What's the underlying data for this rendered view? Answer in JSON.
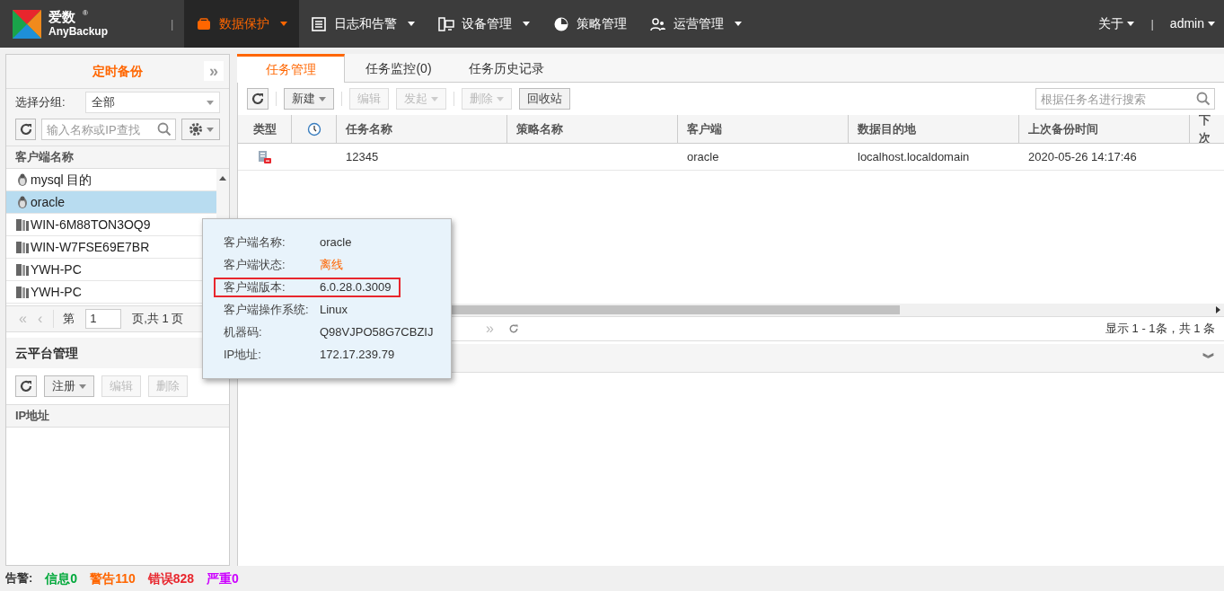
{
  "header": {
    "logo_title": "爱数",
    "logo_mark": "®",
    "logo_subtitle": "AnyBackup",
    "separator": "|",
    "nav": [
      {
        "label": "数据保护",
        "selected": true,
        "dropdown": true
      },
      {
        "label": "日志和告警",
        "selected": false,
        "dropdown": true
      },
      {
        "label": "设备管理",
        "selected": false,
        "dropdown": true
      },
      {
        "label": "策略管理",
        "selected": false,
        "dropdown": false
      },
      {
        "label": "运营管理",
        "selected": false,
        "dropdown": true
      }
    ],
    "right": [
      {
        "label": "关于",
        "dropdown": true
      },
      {
        "label": "admin",
        "dropdown": true
      }
    ],
    "right_separator": "|"
  },
  "sidebar": {
    "title": "定时备份",
    "collapse": "»",
    "group_label": "选择分组:",
    "group_value": "全部",
    "search_placeholder": "输入名称或IP查找",
    "column": "客户端名称",
    "clients": [
      {
        "name": "mysql 目的",
        "kind": "linux",
        "selected": false
      },
      {
        "name": "oracle",
        "kind": "linux",
        "selected": true
      },
      {
        "name": "WIN-6M88TON3OQ9",
        "kind": "windows",
        "selected": false
      },
      {
        "name": "WIN-W7FSE69E7BR",
        "kind": "windows",
        "selected": false
      },
      {
        "name": "YWH-PC",
        "kind": "windows",
        "selected": false
      },
      {
        "name": "YWH-PC",
        "kind": "windows",
        "selected": false
      }
    ],
    "pager": {
      "first": "«",
      "prev": "‹",
      "page_label": "第",
      "page": "1",
      "total": "页,共 1 页"
    },
    "cloud": {
      "title": "云平台管理",
      "buttons": [
        {
          "label": "注册",
          "disabled": false,
          "dropdown": true
        },
        {
          "label": "编辑",
          "disabled": true,
          "dropdown": false
        },
        {
          "label": "删除",
          "disabled": true,
          "dropdown": false
        }
      ],
      "column": "IP地址"
    }
  },
  "main": {
    "tabs": [
      {
        "label": "任务管理",
        "selected": true
      },
      {
        "label": "任务监控(0)",
        "selected": false
      },
      {
        "label": "任务历史记录",
        "selected": false
      }
    ],
    "toolbar": [
      {
        "label": "新建",
        "disabled": false,
        "dropdown": true
      },
      {
        "label": "编辑",
        "disabled": true,
        "dropdown": false
      },
      {
        "label": "发起",
        "disabled": true,
        "dropdown": true
      },
      {
        "label": "删除",
        "disabled": true,
        "dropdown": true
      },
      {
        "label": "回收站",
        "disabled": false,
        "dropdown": false
      }
    ],
    "search_placeholder": "根据任务名进行搜索",
    "table": {
      "columns": [
        {
          "kind": "text",
          "label": "类型"
        },
        {
          "kind": "clock"
        },
        {
          "kind": "text",
          "label": "任务名称"
        },
        {
          "kind": "text",
          "label": "策略名称"
        },
        {
          "kind": "text",
          "label": "客户端"
        },
        {
          "kind": "text",
          "label": "数据目的地"
        },
        {
          "kind": "text",
          "label": "上次备份时间"
        },
        {
          "kind": "text",
          "label": "下次"
        }
      ],
      "rows": [
        {
          "kind": "database",
          "task": "12345",
          "policy": "",
          "client": "oracle",
          "destination": "localhost.localdomain",
          "last_backup": "2020-05-26 14:17:46"
        }
      ]
    },
    "pager": {
      "next": "»",
      "summary": "显示 1 - 1条，共 1 条"
    },
    "detail_toggle": "︾"
  },
  "tooltip": {
    "rows": [
      {
        "label": "客户端名称:",
        "value": "oracle",
        "kind": "text",
        "highlighted": false
      },
      {
        "label": "客户端状态:",
        "value": "离线",
        "kind": "status",
        "highlighted": false
      },
      {
        "label": "客户端版本:",
        "value": "6.0.28.0.3009",
        "kind": "text",
        "highlighted": true
      },
      {
        "label": "客户端操作系统:",
        "value": "Linux",
        "kind": "text",
        "highlighted": false
      },
      {
        "label": "机器码:",
        "value": "Q98VJPO58G7CBZIJ",
        "kind": "text",
        "highlighted": false
      },
      {
        "label": "IP地址:",
        "value": "172.17.239.79",
        "kind": "text",
        "highlighted": false
      }
    ]
  },
  "status_bar": {
    "label": "告警:",
    "alerts": [
      {
        "label": "信息0",
        "color": "#00a83a"
      },
      {
        "label": "警告110",
        "color": "#ff6600"
      },
      {
        "label": "错误828",
        "color": "#e8262d"
      },
      {
        "label": "严重0",
        "color": "#cc00ff"
      }
    ]
  }
}
